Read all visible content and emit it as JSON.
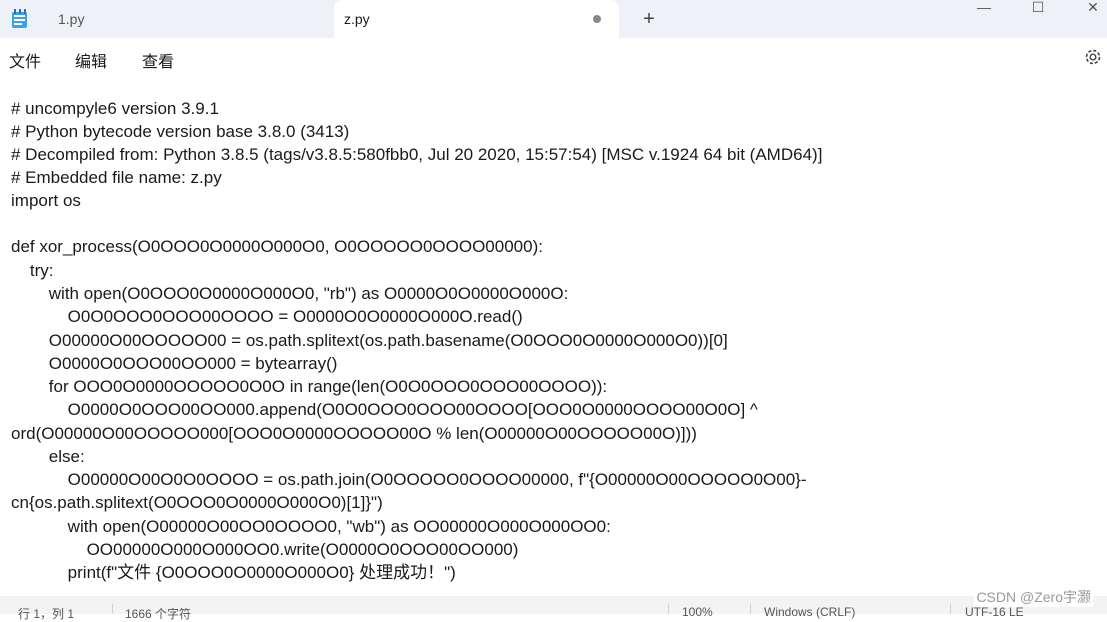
{
  "tabs": [
    {
      "label": "1.py",
      "active": false
    },
    {
      "label": "z.py",
      "active": true,
      "unsaved": true
    }
  ],
  "window_controls": {
    "minimize": "—",
    "maximize": "☐",
    "close": "✕"
  },
  "new_tab_label": "+",
  "menu": [
    "文件",
    "编辑",
    "查看"
  ],
  "code_lines": [
    "# uncompyle6 version 3.9.1",
    "# Python bytecode version base 3.8.0 (3413)",
    "# Decompiled from: Python 3.8.5 (tags/v3.8.5:580fbb0, Jul 20 2020, 15:57:54) [MSC v.1924 64 bit (AMD64)]",
    "# Embedded file name: z.py",
    "import os",
    "",
    "def xor_process(O0OOO0O0000O000O0, O0OOOOO0OOOO00000):",
    "    try:",
    "        with open(O0OOO0O0000O000O0, \"rb\") as O0000O0O0000O000O:",
    "            O0O0OOO0OOO00OOOO = O0000O0O0000O000O.read()",
    "        O00000O00OOOOO00 = os.path.splitext(os.path.basename(O0OOO0O0000O000O0))[0]",
    "        O0000O0OOO00OO000 = bytearray()",
    "        for OOO0O0000OOOOO0O0O in range(len(O0O0OOO0OOO00OOOO)):",
    "            O0000O0OOO00OO000.append(O0O0OOO0OOO00OOOO[OOO0O0000OOOO00O0O] ^",
    "ord(O00000O00OOOOO000[OOO0O0000OOOOO00O % len(O00000O00OOOOO00O)]))",
    "        else:",
    "            O00000O00O0O0OOOO = os.path.join(O0OOOOO0OOOO00000, f\"{O00000O00OOOOO0O00}-",
    "cn{os.path.splitext(O0OOO0O0000O000O0)[1]}\")",
    "            with open(O00000O00OO0OOOO0, \"wb\") as OO00000O000O000OO0:",
    "                OO00000O000O000OO0.write(O0000O0OOO00OO000)",
    "            print(f\"文件 {O0OOO0O0000O000O0} 处理成功！\")"
  ],
  "status_bar": {
    "position": "行 1，列 1",
    "char_count": "1666 个字符",
    "zoom": "100%",
    "line_ending": "Windows (CRLF)",
    "encoding": "UTF-16 LE"
  },
  "watermark": "CSDN @Zero宇灏",
  "icons": {
    "app": "notepad-icon",
    "settings": "gear-icon"
  }
}
